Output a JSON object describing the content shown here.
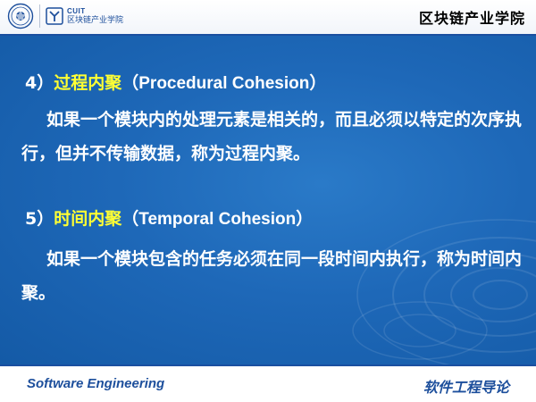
{
  "header": {
    "logo_text_top": "CUIT",
    "logo_text_bottom": "区块链产业学院",
    "title": "区块链产业学院"
  },
  "sections": [
    {
      "number": "4）",
      "term": "过程内聚",
      "english": "（Procedural Cohesion）",
      "paragraph": "如果一个模块内的处理元素是相关的，而且必须以特定的次序执行，但并不传输数据，称为过程内聚。"
    },
    {
      "number": "5）",
      "term": "时间内聚",
      "english": "（Temporal Cohesion）",
      "paragraph": "如果一个模块包含的任务必须在同一段时间内执行，称为时间内聚。"
    }
  ],
  "footer": {
    "left": "Software Engineering",
    "right": "软件工程导论"
  },
  "colors": {
    "background": "#1e68b8",
    "term_highlight": "#ffff33",
    "text": "#ffffff",
    "brand": "#1d4f9c"
  }
}
